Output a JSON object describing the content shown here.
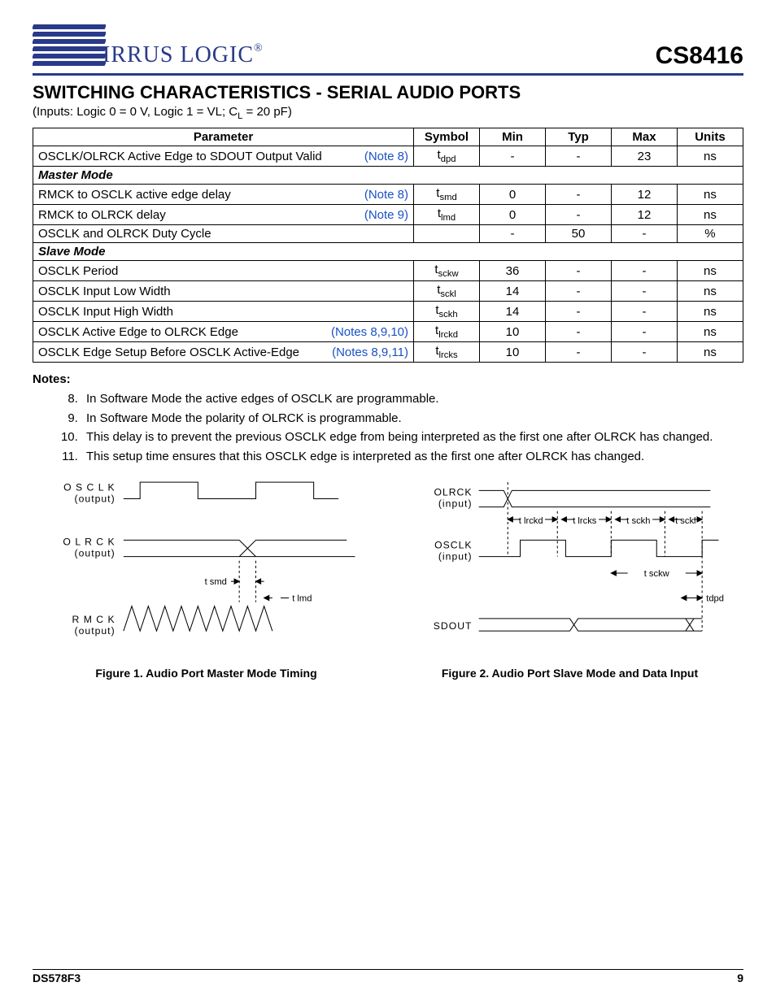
{
  "header": {
    "brand_word": "IRRUS LOGIC",
    "reg": "®",
    "part": "CS8416"
  },
  "section": {
    "title": "SWITCHING CHARACTERISTICS - SERIAL AUDIO PORTS",
    "conditions_pre": "(Inputs: Logic 0 = 0 V, Logic 1 = VL; C",
    "conditions_sub": "L",
    "conditions_post": " = 20 pF)"
  },
  "table": {
    "headers": [
      "Parameter",
      "Symbol",
      "Min",
      "Typ",
      "Max",
      "Units"
    ],
    "rows": [
      {
        "param": "OSCLK/OLRCK Active Edge to SDOUT Output Valid",
        "note": "(Note 8)",
        "sym": "t",
        "sub": "dpd",
        "min": "-",
        "typ": "-",
        "max": "23",
        "units": "ns"
      },
      {
        "mode": "Master Mode"
      },
      {
        "param": "RMCK to OSCLK active edge delay",
        "note": "(Note 8)",
        "sym": "t",
        "sub": "smd",
        "min": "0",
        "typ": "-",
        "max": "12",
        "units": "ns"
      },
      {
        "param": "RMCK to OLRCK delay",
        "note": "(Note 9)",
        "sym": "t",
        "sub": "lmd",
        "min": "0",
        "typ": "-",
        "max": "12",
        "units": "ns"
      },
      {
        "param": "OSCLK and OLRCK Duty Cycle",
        "note": "",
        "sym": "",
        "sub": "",
        "min": "-",
        "typ": "50",
        "max": "-",
        "units": "%"
      },
      {
        "mode": "Slave Mode"
      },
      {
        "param": "OSCLK Period",
        "note": "",
        "sym": "t",
        "sub": "sckw",
        "min": "36",
        "typ": "-",
        "max": "-",
        "units": "ns"
      },
      {
        "param": "OSCLK Input Low Width",
        "note": "",
        "sym": "t",
        "sub": "sckl",
        "min": "14",
        "typ": "-",
        "max": "-",
        "units": "ns"
      },
      {
        "param": "OSCLK Input High Width",
        "note": "",
        "sym": "t",
        "sub": "sckh",
        "min": "14",
        "typ": "-",
        "max": "-",
        "units": "ns"
      },
      {
        "param": "OSCLK Active Edge to OLRCK Edge",
        "note": "(Notes 8,9,10)",
        "sym": "t",
        "sub": "lrckd",
        "min": "10",
        "typ": "-",
        "max": "-",
        "units": "ns"
      },
      {
        "param": "OSCLK Edge Setup Before OSCLK Active-Edge",
        "note": "(Notes 8,9,11)",
        "sym": "t",
        "sub": "lrcks",
        "min": "10",
        "typ": "-",
        "max": "-",
        "units": "ns"
      }
    ]
  },
  "notes_label": "Notes:",
  "notes": [
    "In Software Mode the active edges of OSCLK are programmable.",
    "In Software Mode the polarity of OLRCK is programmable.",
    "This delay is to prevent the previous OSCLK edge from being interpreted as the first one after OLRCK has changed.",
    "This setup time ensures that this OSCLK edge is interpreted as the first one after OLRCK has changed."
  ],
  "fig1": {
    "caption": "Figure 1.  Audio Port Master Mode Timing",
    "sig1": "O S C L K",
    "sig1b": "(output)",
    "sig2": "O L R C K",
    "sig2b": "(output)",
    "sig3": "R M C K",
    "sig3b": "(output)",
    "t_smd": "t smd",
    "t_lmd": "t lmd"
  },
  "fig2": {
    "caption": "Figure 2.  Audio Port Slave Mode and Data Input",
    "sig1": "OLRCK",
    "sig1b": "(input)",
    "sig2": "OSCLK",
    "sig2b": "(input)",
    "sig3": "SDOUT",
    "t_lrckd": "t lrckd",
    "t_lrcks": "t lrcks",
    "t_sckh": "t sckh",
    "t_sckl": "t sckl",
    "t_sckw": "t sckw",
    "t_dpd": "tdpd"
  },
  "footer": {
    "left": "DS578F3",
    "right": "9"
  }
}
